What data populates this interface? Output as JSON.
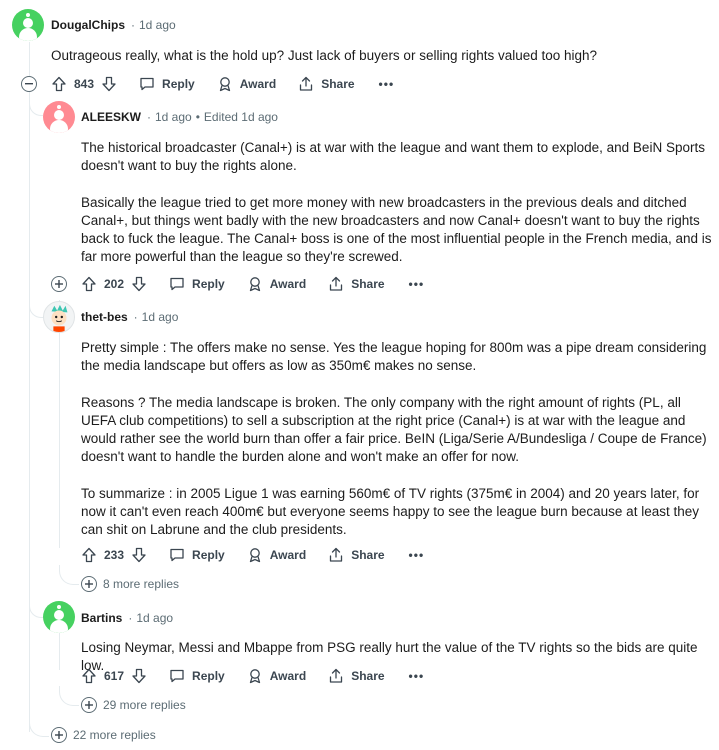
{
  "comments": [
    {
      "username": "DougalChips",
      "time": "1d ago",
      "edited": "",
      "body": [
        "Outrageous really, what is the hold up? Just lack of buyers or selling rights valued too high?"
      ],
      "score": "843"
    },
    {
      "username": "ALEESKW",
      "time": "1d ago",
      "edited": "Edited 1d ago",
      "body": [
        "The historical broadcaster (Canal+) is at war with the league and want them to explode, and BeiN Sports doesn't want to buy the rights alone.",
        "Basically the league tried to get more money with new broadcasters in the previous deals and ditched Canal+, but things went badly with the new broadcasters and now Canal+ doesn't want to buy the rights back to fuck the league. The Canal+ boss is one of the most influential people in the French media, and is far more powerful than the league so they're screwed."
      ],
      "score": "202"
    },
    {
      "username": "thet-bes",
      "time": "1d ago",
      "edited": "",
      "body": [
        "Pretty simple : The offers make no sense. Yes the league hoping for 800m was a pipe dream considering the media landscape but offers as low as 350m€ makes no sense.",
        "Reasons ? The media landscape is broken. The only company with the right amount of rights (PL, all UEFA club competitions) to sell a subscription at the right price (Canal+) is at war with the league and would rather see the world burn than offer a fair price. BeIN (Liga/Serie A/Bundesliga / Coupe de France) doesn't want to handle the burden alone and won't make an offer for now.",
        "To summarize : in 2005 Ligue 1 was earning 560m€ of TV rights (375m€ in 2004) and 20 years later, for now it can't even reach 400m€ but everyone seems happy to see the league burn because at least they can shit on Labrune and the club presidents."
      ],
      "score": "233",
      "more_replies": "8 more replies"
    },
    {
      "username": "Bartins",
      "time": "1d ago",
      "edited": "",
      "body": [
        "Losing Neymar, Messi and Mbappe from PSG really hurt the value of the TV rights so the bids are quite low."
      ],
      "score": "617",
      "more_replies": "29 more replies"
    }
  ],
  "thread_more_replies": "22 more replies",
  "actions": {
    "reply": "Reply",
    "award": "Award",
    "share": "Share",
    "more": "•••"
  },
  "colors": {
    "accent_green": "#46d160",
    "accent_pink": "#ff585b",
    "meta_gray": "#5c6c74"
  }
}
